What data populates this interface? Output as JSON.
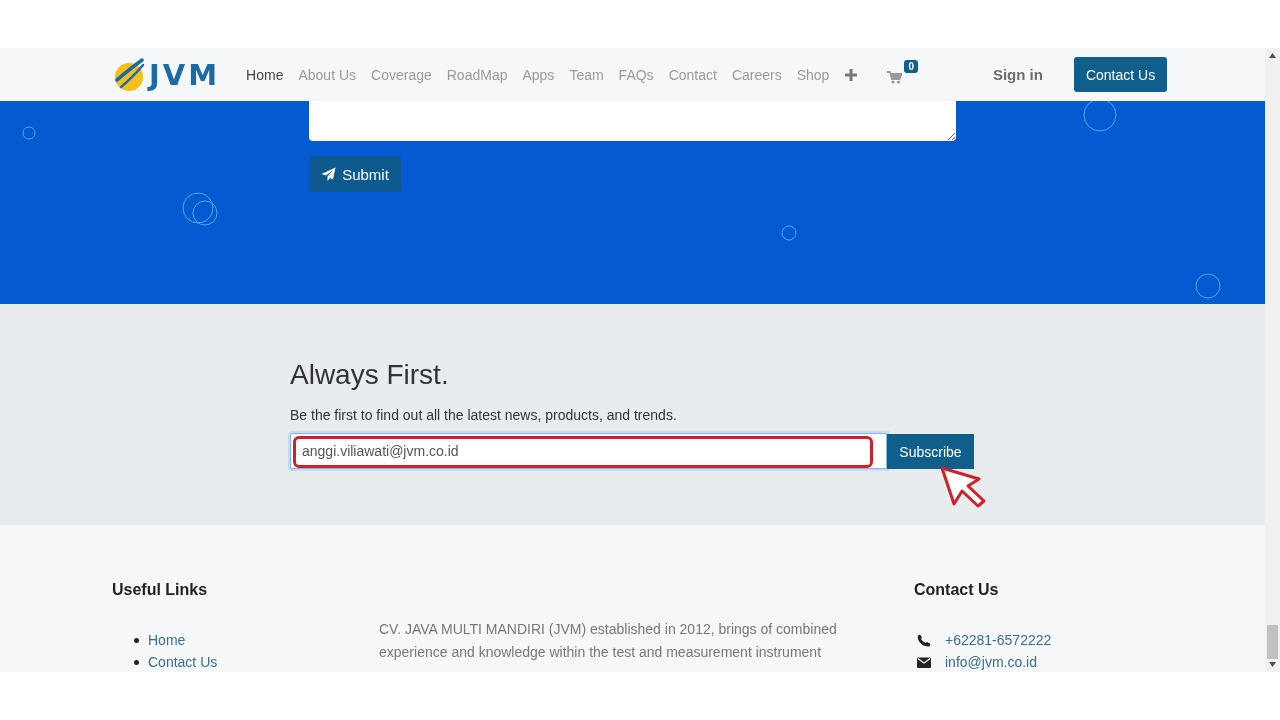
{
  "nav": {
    "logo_text": "JVM",
    "links": [
      {
        "label": "Home",
        "selected": true
      },
      {
        "label": "About Us",
        "selected": false
      },
      {
        "label": "Coverage",
        "selected": false
      },
      {
        "label": "RoadMap",
        "selected": false
      },
      {
        "label": "Apps",
        "selected": false
      },
      {
        "label": "Team",
        "selected": false
      },
      {
        "label": "FAQs",
        "selected": false
      },
      {
        "label": "Contact",
        "selected": false
      },
      {
        "label": "Careers",
        "selected": false
      },
      {
        "label": "Shop",
        "selected": false
      }
    ],
    "cart_count": "0",
    "sign_in": "Sign in",
    "cta": "Contact Us"
  },
  "contact_form": {
    "submit": "Submit"
  },
  "newsletter": {
    "title": "Always First.",
    "subtitle": "Be the first to find out all the latest news, products, and trends.",
    "email_value": "anggi.viliawati@jvm.co.id",
    "button": "Subscribe"
  },
  "annotations": {
    "input_highlighted": true,
    "pointer_on_button": true
  },
  "footer": {
    "useful_links": {
      "title": "Useful Links",
      "links": [
        "Home",
        "Contact Us"
      ]
    },
    "about": "CV. JAVA MULTI MANDIRI (JVM) established in 2012, brings of combined experience and knowledge within the test and measurement instrument",
    "contact": {
      "title": "Contact Us",
      "items": [
        {
          "kind": "phone",
          "text": "+62281-6572222"
        },
        {
          "kind": "email",
          "text": "info@jvm.co.id"
        }
      ]
    }
  }
}
